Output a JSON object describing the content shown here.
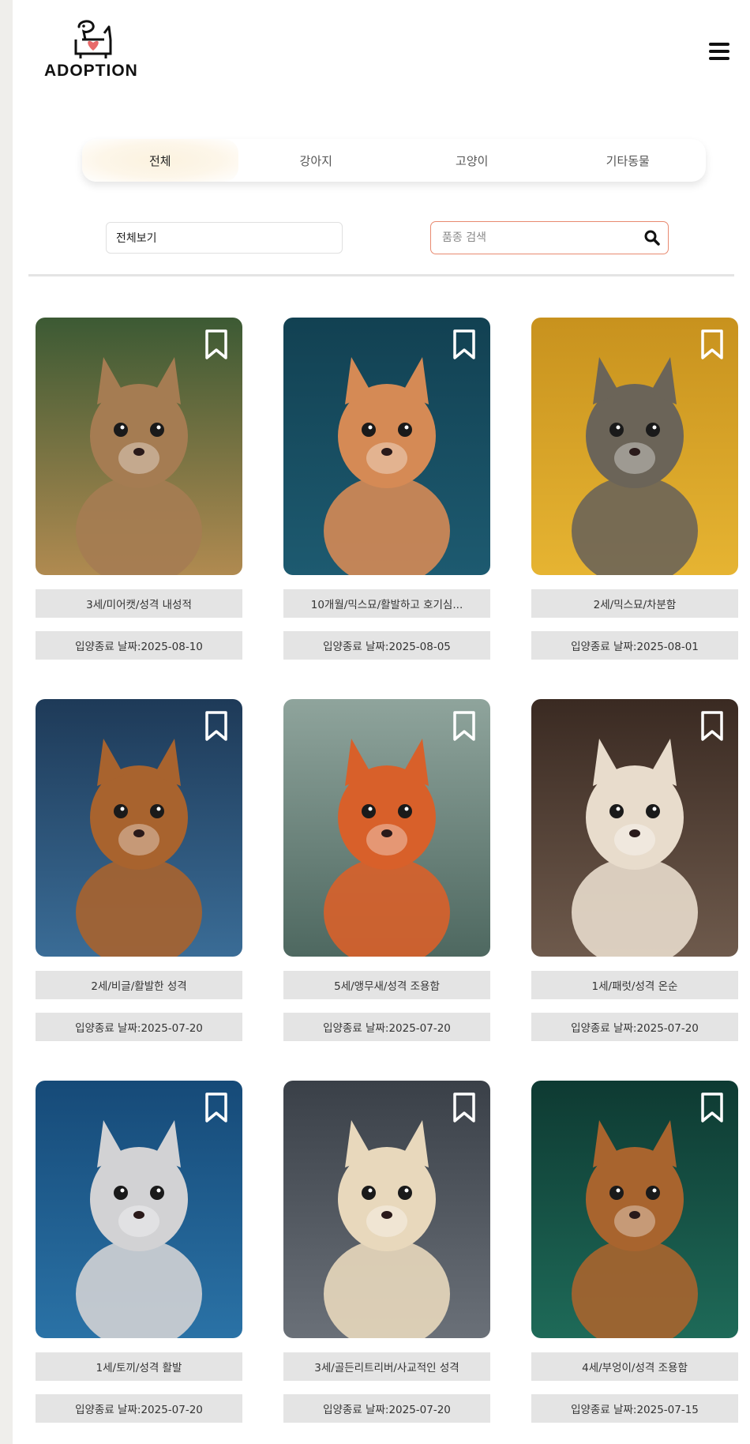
{
  "header": {
    "logo_text": "ADOPTION",
    "menu_icon": "hamburger-menu-icon"
  },
  "tabs": [
    {
      "label": "전체",
      "active": true
    },
    {
      "label": "강아지",
      "active": false
    },
    {
      "label": "고양이",
      "active": false
    },
    {
      "label": "기타동물",
      "active": false
    }
  ],
  "filter": {
    "select_value": "전체보기",
    "search_placeholder": "품종 검색",
    "search_icon": "search-icon",
    "accent_color": "#e88a70"
  },
  "cards": [
    {
      "label": "3세/미어캣/성격 내성적",
      "date": "입양종료 날짜:2025-08-10",
      "animal": "meerkat",
      "bg": [
        "#3c5a34",
        "#b08a50"
      ],
      "accent": "#a57c52"
    },
    {
      "label": "10개월/믹스묘/활발하고 호기심...",
      "date": "입양종료 날짜:2025-08-05",
      "animal": "orange-kitten",
      "bg": [
        "#124152",
        "#1d5a70"
      ],
      "accent": "#d58a55"
    },
    {
      "label": "2세/믹스묘/차분함",
      "date": "입양종료 날짜:2025-08-01",
      "animal": "tabby-cat",
      "bg": [
        "#c8921e",
        "#e6b432"
      ],
      "accent": "#6b6458"
    },
    {
      "label": "2세/비글/활발한 성격",
      "date": "입양종료 날짜:2025-07-20",
      "animal": "beagle",
      "bg": [
        "#1e3a58",
        "#3a6c96"
      ],
      "accent": "#a8632e"
    },
    {
      "label": "5세/앵무새/성격 조용함",
      "date": "입양종료 날짜:2025-07-20",
      "animal": "parrot",
      "bg": [
        "#8fa49c",
        "#4e6860"
      ],
      "accent": "#d8602a"
    },
    {
      "label": "1세/패럿/성격 온순",
      "date": "입양종료 날짜:2025-07-20",
      "animal": "ferret",
      "bg": [
        "#3a2a22",
        "#6e5a4c"
      ],
      "accent": "#e8dccc"
    },
    {
      "label": "1세/토끼/성격 활발",
      "date": "입양종료 날짜:2025-07-20",
      "animal": "rabbit",
      "bg": [
        "#164a78",
        "#2a72a6"
      ],
      "accent": "#d2d2d4"
    },
    {
      "label": "3세/골든리트리버/사교적인 성격",
      "date": "입양종료 날짜:2025-07-20",
      "animal": "golden-retriever",
      "bg": [
        "#3a4048",
        "#6a7078"
      ],
      "accent": "#e8d8bc"
    },
    {
      "label": "4세/부엉이/성격 조용함",
      "date": "입양종료 날짜:2025-07-15",
      "animal": "owl",
      "bg": [
        "#0e3a32",
        "#1e6a58"
      ],
      "accent": "#a8642e"
    }
  ]
}
